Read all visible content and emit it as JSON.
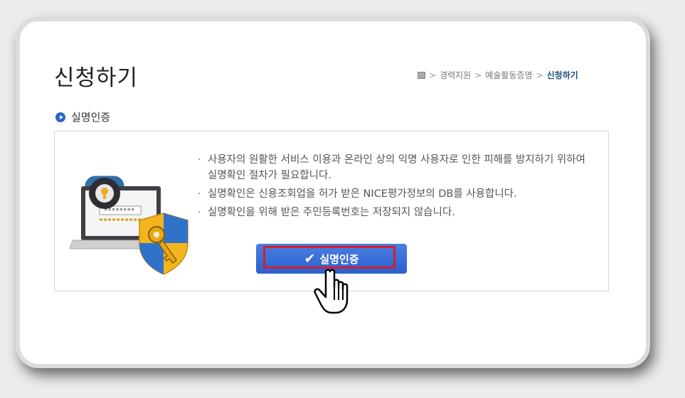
{
  "page": {
    "title": "신청하기"
  },
  "breadcrumb": {
    "items": [
      "경력지원",
      "예술활동증명",
      "신청하기"
    ],
    "separator": ">"
  },
  "section": {
    "heading": "실명인증"
  },
  "notices": [
    "사용자의 원활한 서비스 이용과 온라인 상의 익명 사용자로 인한 피해를 방지하기 위하여 실명확인 절차가 필요합니다.",
    "실명확인은 신용조회업을 허가 받은 NICE평가정보의 DB를 사용합니다.",
    "실명확인을 위해 받은 주민등록번호는 저장되지 않습니다."
  ],
  "button": {
    "label": "실명인증"
  },
  "colors": {
    "accent": "#2a5fcf",
    "highlight": "#d21f2a",
    "breadcrumb_current": "#1c4f7c"
  },
  "icons": {
    "home": "home-icon",
    "bullet": "bullet-icon",
    "check": "check-icon",
    "cursor": "hand-cursor-icon"
  }
}
